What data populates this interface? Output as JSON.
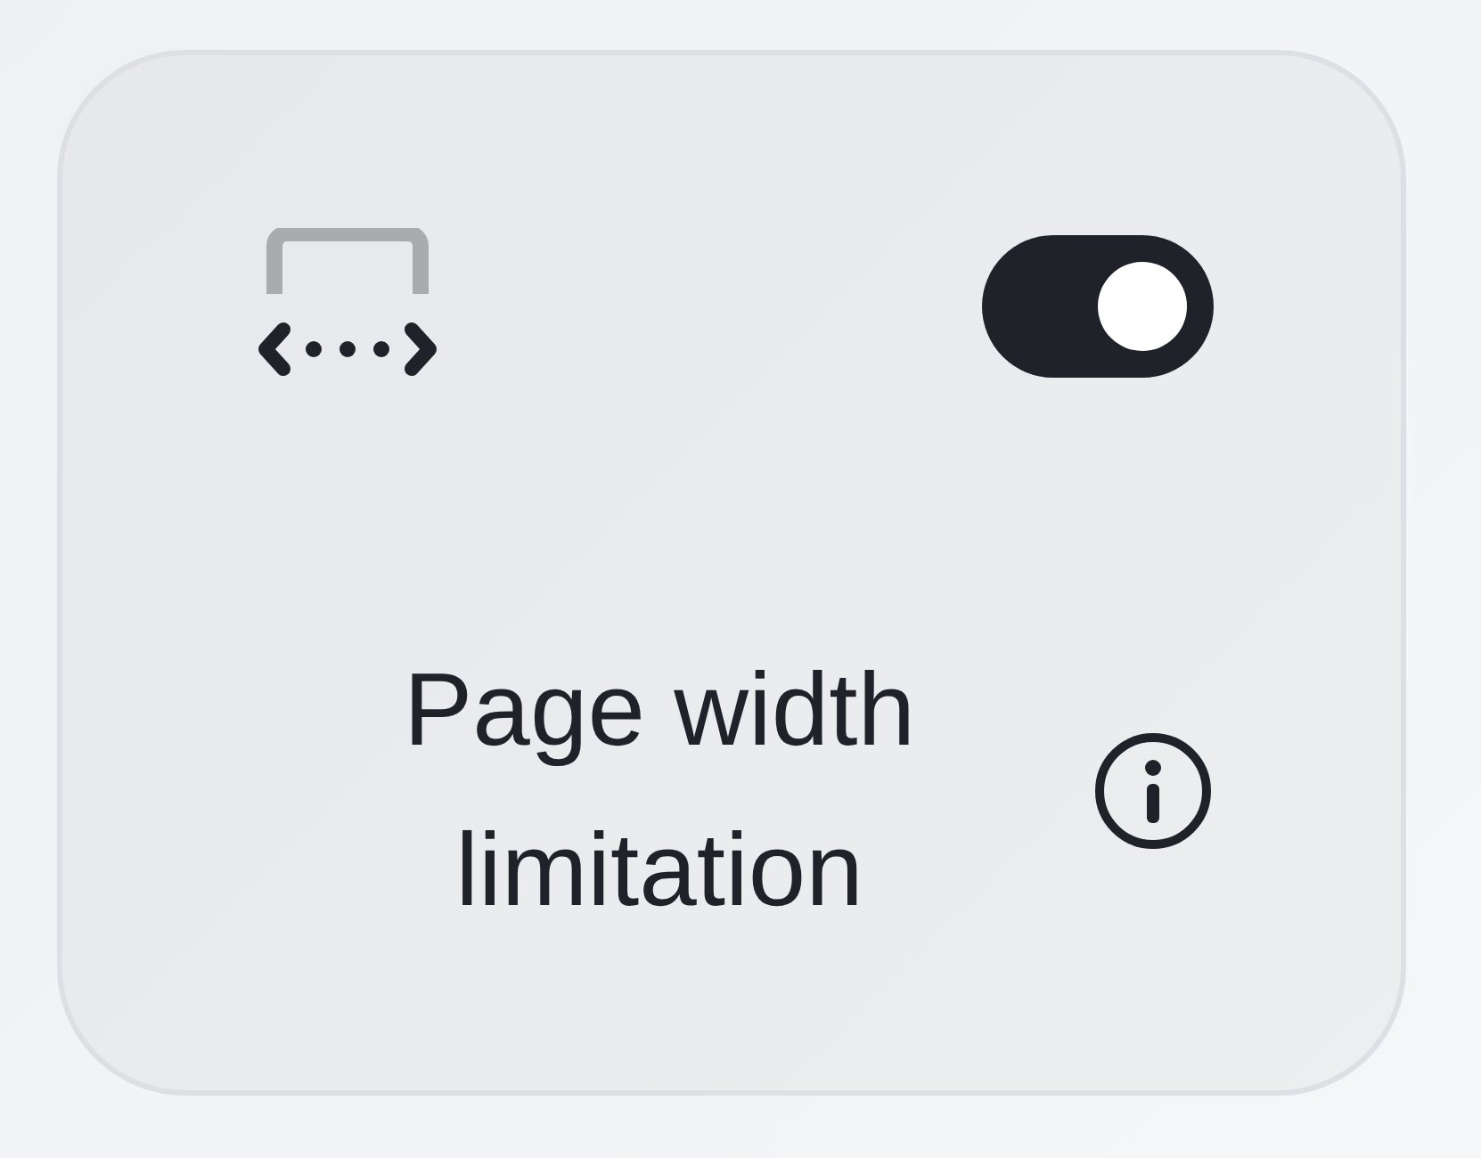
{
  "card": {
    "toggle": {
      "on": true
    },
    "label": "Page width limitation"
  }
}
